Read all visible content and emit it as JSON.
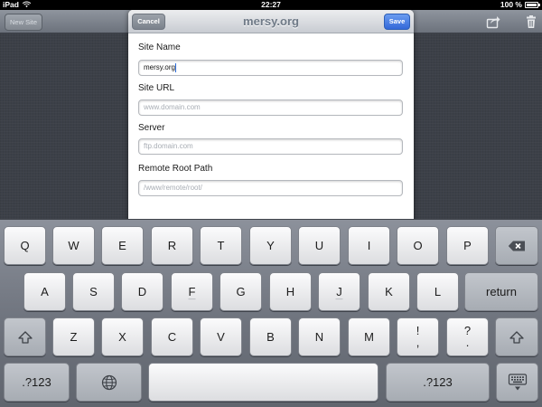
{
  "status_bar": {
    "carrier": "iPad",
    "time": "22:27",
    "battery_percent": "100 %",
    "battery_level": 1.0,
    "wifi_icon": "wifi-icon",
    "battery_icon": "battery-icon"
  },
  "toolbar": {
    "new_site_label": "New Site",
    "share_icon": "share-icon",
    "trash_icon": "trash-icon"
  },
  "sheet": {
    "title": "mersy.org",
    "cancel_label": "Cancel",
    "save_label": "Save",
    "fields": [
      {
        "label": "Site Name",
        "value": "mersy.org",
        "placeholder": ""
      },
      {
        "label": "Site URL",
        "value": "",
        "placeholder": "www.domain.com"
      },
      {
        "label": "Server",
        "value": "",
        "placeholder": "ftp.domain.com"
      },
      {
        "label": "Remote Root Path",
        "value": "",
        "placeholder": "/www/remote/root/"
      }
    ]
  },
  "keyboard": {
    "row1": [
      "Q",
      "W",
      "E",
      "R",
      "T",
      "Y",
      "U",
      "I",
      "O",
      "P"
    ],
    "row2": [
      "A",
      "S",
      "D",
      "F",
      "G",
      "H",
      "J",
      "K",
      "L"
    ],
    "row3": [
      "Z",
      "X",
      "C",
      "V",
      "B",
      "N",
      "M"
    ],
    "punct_excl": {
      "top": "!",
      "bottom": ","
    },
    "punct_quest": {
      "top": "?",
      "bottom": "."
    },
    "return_label": "return",
    "numbers_label": ".?123",
    "icons": [
      "delete-icon",
      "shift-icon",
      "globe-icon",
      "keyboard-dismiss-icon"
    ]
  },
  "colors": {
    "save_blue": "#3368d9",
    "caret_blue": "#2a6ad8",
    "title_gray": "#6f7a87"
  }
}
